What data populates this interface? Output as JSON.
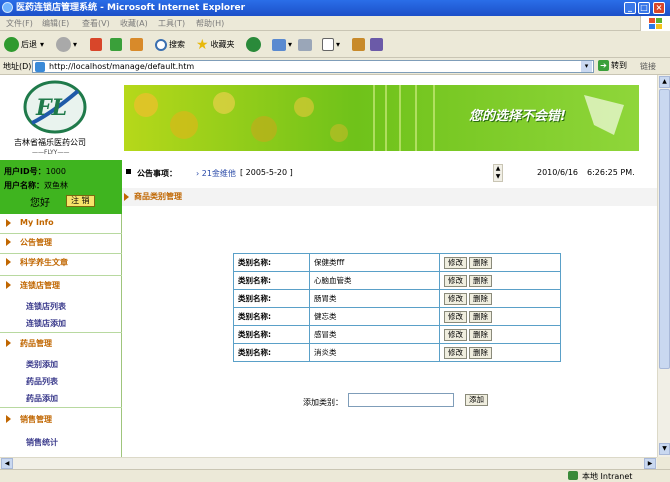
{
  "window": {
    "title": "医药连锁店管理系统 - Microsoft Internet Explorer"
  },
  "menubar": [
    "文件(F)",
    "编辑(E)",
    "查看(V)",
    "收藏(A)",
    "工具(T)",
    "帮助(H)"
  ],
  "toolbar": {
    "back": "后退",
    "search": "搜索",
    "favorites": "收藏夹"
  },
  "address": {
    "label": "地址(D)",
    "url": "http://localhost/manage/default.htm",
    "go": "转到",
    "links": "链接"
  },
  "logo": {
    "letters": "FL",
    "company": "吉林省福乐医药公司",
    "tagline": "——FLYY——"
  },
  "user": {
    "id_label": "用户ID号：",
    "id_value": "1000",
    "name_label": "用户名称：",
    "name_value": "双鱼林",
    "greeting": "您好",
    "logout": "注 销"
  },
  "nav": {
    "my_info": "My Info",
    "notice": "公告管理",
    "article": "科学养生文章",
    "chain": "连锁店管理",
    "chain_list": "连锁店列表",
    "chain_add": "连锁店添加",
    "drug": "药品管理",
    "cat_add": "类别添加",
    "drug_list": "药品列表",
    "drug_add": "药品添加",
    "sales": "销售管理",
    "sales_stat": "销售统计"
  },
  "banner": {
    "slogan": "您的选择不会错!"
  },
  "notice": {
    "label": "公告事项：",
    "item_title": "21金维他",
    "item_date": "[ 2005-5-20 ]",
    "date": "2010/6/16",
    "time": "6:26:25 PM."
  },
  "section": {
    "title": "商品类别管理"
  },
  "categories": {
    "label": "类别名称:",
    "edit": "修改",
    "delete": "删除",
    "rows": [
      "保健类fff",
      "心脑血管类",
      "肠胃类",
      "健忘类",
      "感冒类",
      "消炎类"
    ]
  },
  "add_form": {
    "label": "添加类别：",
    "value": "",
    "button": "添加"
  },
  "status": {
    "zone": "本地 Intranet"
  },
  "colors": {
    "sidebar_green": "#3fb41f",
    "nav_orange": "#c06600",
    "table_border": "#5aa0c8"
  }
}
